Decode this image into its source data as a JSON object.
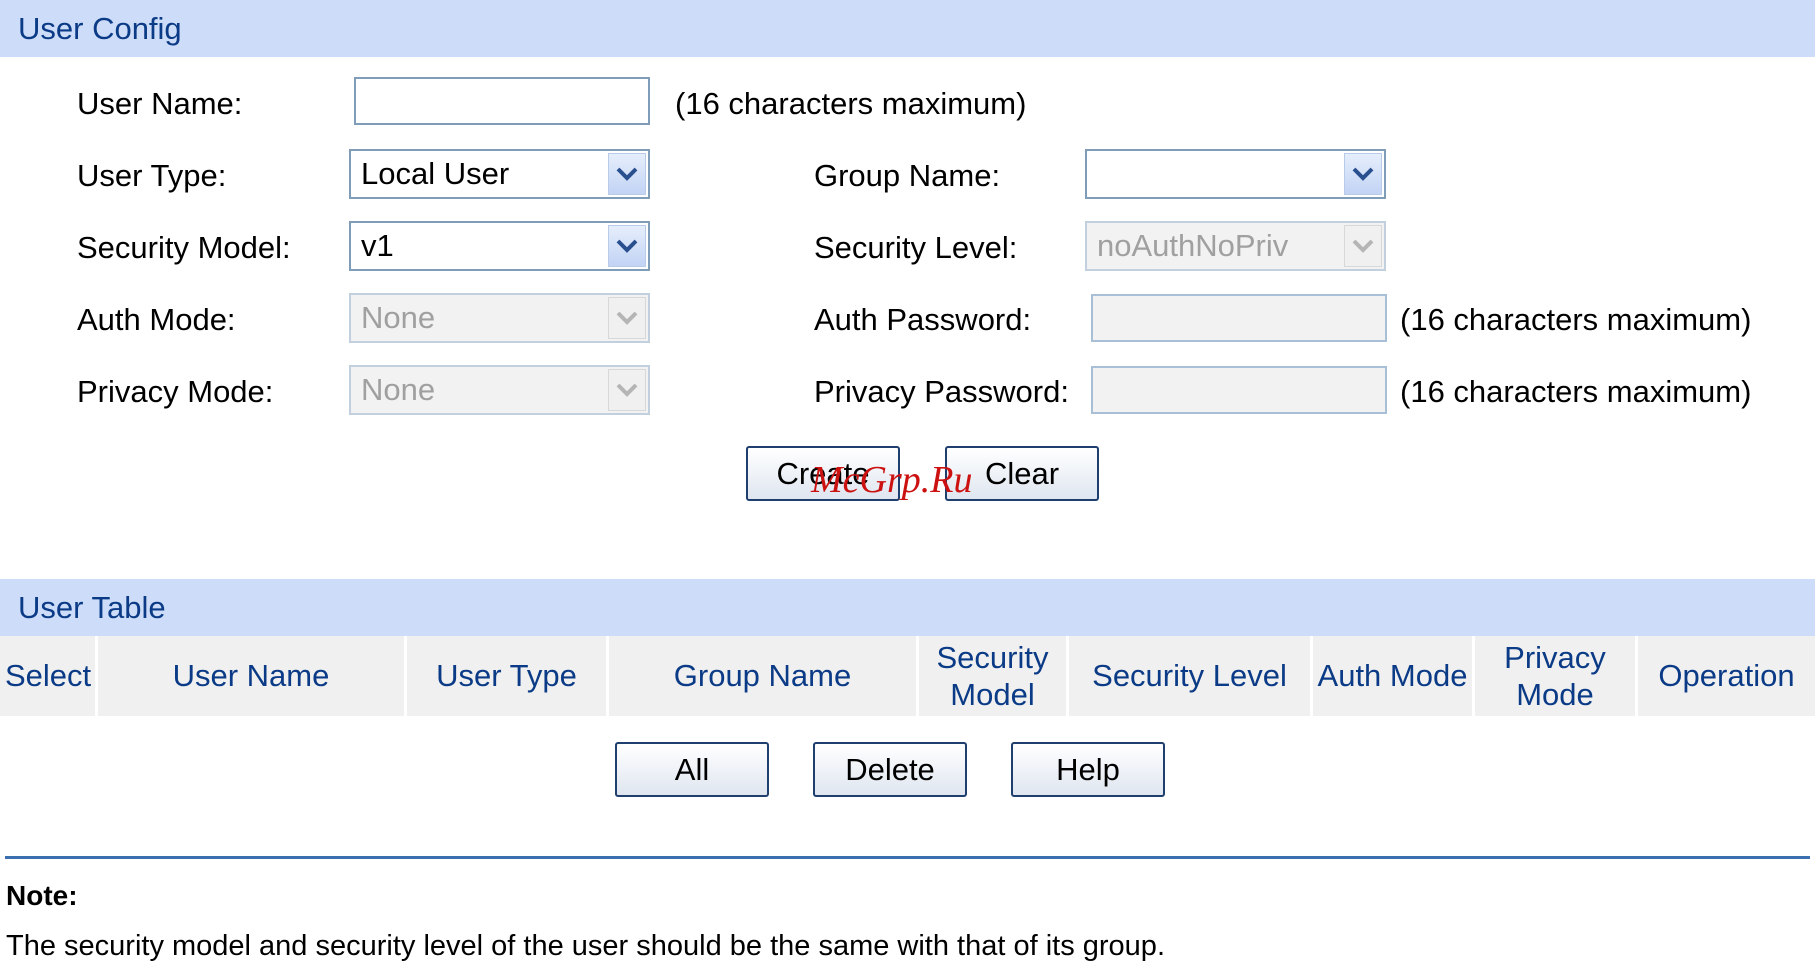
{
  "user_config": {
    "header": "User Config",
    "user_name_label": "User Name:",
    "user_name_value": "",
    "user_name_hint": "(16 characters maximum)",
    "user_type_label": "User Type:",
    "user_type_value": "Local User",
    "group_name_label": "Group Name:",
    "group_name_value": "",
    "security_model_label": "Security Model:",
    "security_model_value": "v1",
    "security_level_label": "Security Level:",
    "security_level_value": "noAuthNoPriv",
    "auth_mode_label": "Auth Mode:",
    "auth_mode_value": "None",
    "auth_password_label": "Auth Password:",
    "auth_password_hint": "(16 characters maximum)",
    "privacy_mode_label": "Privacy Mode:",
    "privacy_mode_value": "None",
    "privacy_password_label": "Privacy Password:",
    "privacy_password_hint": "(16 characters maximum)",
    "create_button": "Create",
    "clear_button": "Clear"
  },
  "user_table": {
    "header": "User Table",
    "columns": [
      "Select",
      "User Name",
      "User Type",
      "Group Name",
      "Security Model",
      "Security Level",
      "Auth Mode",
      "Privacy Mode",
      "Operation"
    ],
    "all_button": "All",
    "delete_button": "Delete",
    "help_button": "Help"
  },
  "note": {
    "title": "Note:",
    "text": "The security model and security level of the user should be the same with that of its group."
  },
  "watermark": "McGrp.Ru",
  "colors": {
    "section_header_bg": "#cddcf8",
    "section_header_text": "#0b3b86",
    "table_header_bg": "#f0f0f0",
    "divider": "#3a6fb0"
  }
}
